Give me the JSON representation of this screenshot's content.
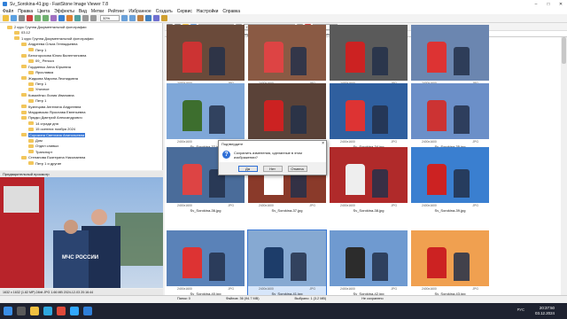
{
  "window": {
    "title": "Sv_Sorokina-41.jpg - FastStone Image Viewer 7.8",
    "controls": [
      "–",
      "□",
      "✕"
    ]
  },
  "menu": [
    "Файл",
    "Правка",
    "Цвета",
    "Эффекты",
    "Вид",
    "Метки",
    "Рейтинг",
    "Избранное",
    "Создать",
    "Сервис",
    "Настройки",
    "Справка"
  ],
  "toolbar": {
    "zoom": "32%"
  },
  "toolbar2": {
    "filter": "Графика и видео",
    "sort": "Свой порядок сортировки",
    "color": "Нейтр"
  },
  "address": "D:\\Станислав Марченко\\03.12\\1 курс Группа Документальной фотографии\\Сорокина Светлана Анатольевна\\МЧС\\МЧС(Сохранённые)\\",
  "tree": [
    {
      "label": "2 курс Группа Документальной фотографии",
      "indent": 1
    },
    {
      "label": "03.12",
      "indent": 2
    },
    {
      "label": "1 курс Группа Документальной фотографии",
      "indent": 2
    },
    {
      "label": "Андреева Ольга Геннадьевна",
      "indent": 3
    },
    {
      "label": "Петр 1",
      "indent": 4
    },
    {
      "label": "Белогорохова Юлия Валентиновна",
      "indent": 3
    },
    {
      "label": "09_ Репосэ",
      "indent": 4
    },
    {
      "label": "Гордиенко Анна Юрьевна",
      "indent": 3
    },
    {
      "label": "Ярославка",
      "indent": 4
    },
    {
      "label": "Жидкова Марина Леонидовна",
      "indent": 3
    },
    {
      "label": "Петр 1",
      "indent": 4
    },
    {
      "label": "Уличное",
      "indent": 4
    },
    {
      "label": "Ковалёнко Лилия Ивановна",
      "indent": 3
    },
    {
      "label": "Петр 1",
      "indent": 4
    },
    {
      "label": "Кузнецова Ангелина Андреевна",
      "indent": 3
    },
    {
      "label": "Мардовская Ярослава Евгеньевна",
      "indent": 3
    },
    {
      "label": "Прядко Дмитрий Александрович",
      "indent": 3
    },
    {
      "label": "14 сгради дня",
      "indent": 4
    },
    {
      "label": "15 осенних ноября 2024",
      "indent": 4
    },
    {
      "label": "Сорокина Светлана Анатольевна",
      "indent": 3,
      "selected": true
    },
    {
      "label": "Дом",
      "indent": 4
    },
    {
      "label": "Отдел сливых",
      "indent": 4
    },
    {
      "label": "Транспорт",
      "indent": 4
    },
    {
      "label": "Степанова Екатерина Николаевна",
      "indent": 3
    },
    {
      "label": "Петр 1 и другие",
      "indent": 4
    }
  ],
  "preview": {
    "header": "Предварительный просмотр",
    "info": "1632 x 1632 (1.82 MP) 24bit JPG 1.66 MB 2024-12-03 20:16:44",
    "mchs_text": "МЧС РОССИИ"
  },
  "thumbs": [
    {
      "name": "Sv_Sorokina-27.jpg",
      "dim": "2400x1600",
      "type": "JPG",
      "bg": "#6a4a3a",
      "accent": "#c33"
    },
    {
      "name": "Sv_Sorokina-28.jpg",
      "dim": "2400x1600",
      "type": "JPG",
      "bg": "#8a5a44",
      "accent": "#d44"
    },
    {
      "name": "Sv_Sorokina-30.jpg",
      "dim": "2400x1600",
      "type": "JPG",
      "bg": "#5a5a5a",
      "accent": "#c22"
    },
    {
      "name": "Sv_Sorokina-31.jpg",
      "dim": "2400x1600",
      "type": "JPG",
      "bg": "#6b86b0",
      "accent": "#d33"
    },
    {
      "name": "Sv_Sorokina-32.jpg",
      "dim": "2400x1600",
      "type": "JPG",
      "bg": "#7fa7d8",
      "accent": "#3d6e2e"
    },
    {
      "name": "Sv_Sorokina-33.jpg",
      "dim": "2400x1600",
      "type": "JPG",
      "bg": "#5a4238",
      "accent": "#c22"
    },
    {
      "name": "Sv_Sorokina-34.jpg",
      "dim": "2400x1600",
      "type": "JPG",
      "bg": "#2f5f9f",
      "accent": "#d33"
    },
    {
      "name": "Sv_Sorokina-35.jpg",
      "dim": "2400x1600",
      "type": "JPG",
      "bg": "#6b8fc8",
      "accent": "#c33"
    },
    {
      "name": "Sv_Sorokina-36.jpg",
      "dim": "2400x1600",
      "type": "JPG",
      "bg": "#4a6c9a",
      "accent": "#d44"
    },
    {
      "name": "Sv_Sorokina-37.jpg",
      "dim": "2400x1600",
      "type": "JPG",
      "bg": "#8a3a2a",
      "accent": "#fff"
    },
    {
      "name": "Sv_Sorokina-38.jpg",
      "dim": "2400x1600",
      "type": "JPG",
      "bg": "#b02a2a",
      "accent": "#eee"
    },
    {
      "name": "Sv_Sorokina-39.jpg",
      "dim": "2400x1600",
      "type": "JPG",
      "bg": "#3a7fd0",
      "accent": "#c22"
    },
    {
      "name": "Sv_Sorokina-40.jpg",
      "dim": "2400x1600",
      "type": "JPG",
      "bg": "#5a82b8",
      "accent": "#d33"
    },
    {
      "name": "Sv_Sorokina-41.jpg",
      "dim": "2400x1600",
      "type": "JPG",
      "bg": "#86a9d2",
      "accent": "#1d3d6a",
      "selected": true
    },
    {
      "name": "Sv_Sorokina-42.jpg",
      "dim": "2400x1600",
      "type": "JPG",
      "bg": "#6f9ad0",
      "accent": "#2c2c2c"
    },
    {
      "name": "Sv_Sorokina-43.jpg",
      "dim": "2400x1600",
      "type": "JPG",
      "bg": "#f0a050",
      "accent": "#c22"
    }
  ],
  "dialog": {
    "title": "Подтвердите",
    "message": "Сохранить изменения, сделанные в этом изображении?",
    "yes": "Да",
    "no": "Нет",
    "cancel": "Отмена"
  },
  "status": {
    "folders": "Папок: 0",
    "files": "Файлов: 36 (94.7 MB)",
    "selected": "Выбрано: 1 (3.2 MB)",
    "changed": "Не сохранено"
  },
  "taskbar": {
    "time": "20:37:50",
    "date": "03.12.2024",
    "lang": "РУС"
  }
}
